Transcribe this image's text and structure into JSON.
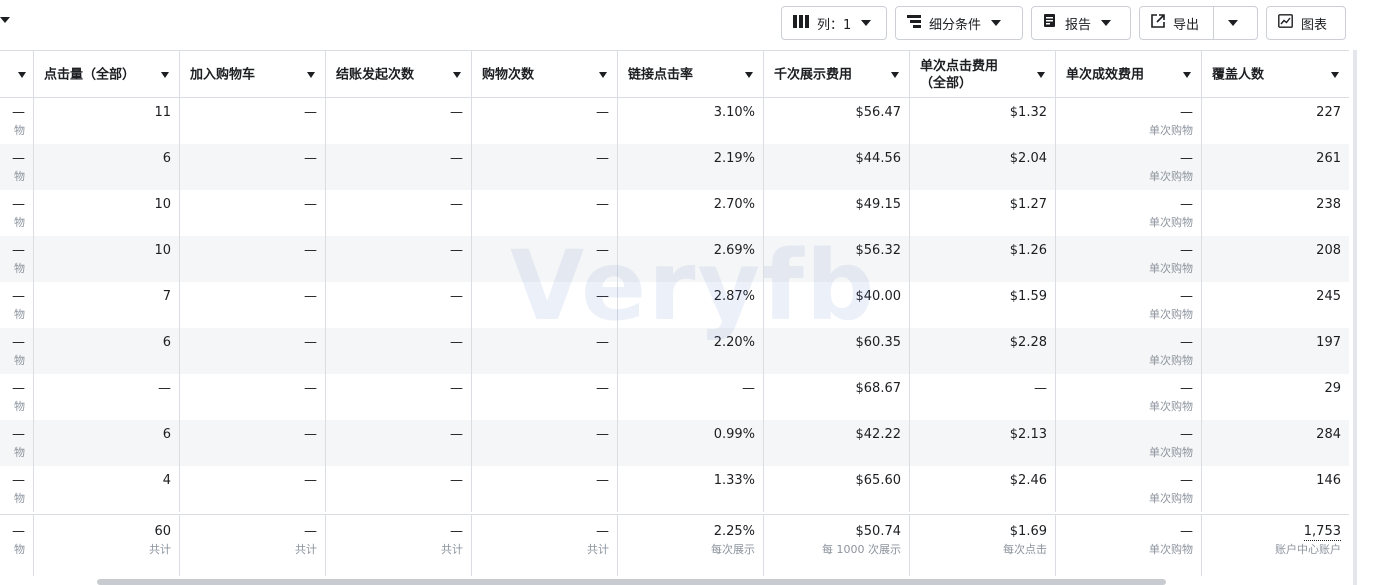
{
  "toolbar": {
    "columns_label": "列：1",
    "breakdown_label": "细分条件",
    "reports_label": "报告",
    "export_label": "导出",
    "charts_label": "图表"
  },
  "watermark": "Veryfb",
  "first_col_partial": {
    "values": [
      "—",
      "—",
      "—",
      "—",
      "—",
      "—",
      "—",
      "—",
      "—"
    ],
    "sub": "物",
    "total_value": "—",
    "total_sub": "物"
  },
  "headers": [
    "点击量（全部）",
    "加入购物车",
    "结账发起次数",
    "购物次数",
    "链接点击率",
    "千次展示费用",
    "单次点击费用\n（全部）",
    "单次成效费用",
    "覆盖人数"
  ],
  "rows": [
    {
      "clicks": "11",
      "atc": "—",
      "checkout": "—",
      "purchases": "—",
      "ctr": "3.10%",
      "cpm": "$56.47",
      "cpc": "$1.32",
      "cpr": "—",
      "cpr_sub": "单次购物",
      "reach": "227"
    },
    {
      "clicks": "6",
      "atc": "—",
      "checkout": "—",
      "purchases": "—",
      "ctr": "2.19%",
      "cpm": "$44.56",
      "cpc": "$2.04",
      "cpr": "—",
      "cpr_sub": "单次购物",
      "reach": "261"
    },
    {
      "clicks": "10",
      "atc": "—",
      "checkout": "—",
      "purchases": "—",
      "ctr": "2.70%",
      "cpm": "$49.15",
      "cpc": "$1.27",
      "cpr": "—",
      "cpr_sub": "单次购物",
      "reach": "238"
    },
    {
      "clicks": "10",
      "atc": "—",
      "checkout": "—",
      "purchases": "—",
      "ctr": "2.69%",
      "cpm": "$56.32",
      "cpc": "$1.26",
      "cpr": "—",
      "cpr_sub": "单次购物",
      "reach": "208"
    },
    {
      "clicks": "7",
      "atc": "—",
      "checkout": "—",
      "purchases": "—",
      "ctr": "2.87%",
      "cpm": "$40.00",
      "cpc": "$1.59",
      "cpr": "—",
      "cpr_sub": "单次购物",
      "reach": "245"
    },
    {
      "clicks": "6",
      "atc": "—",
      "checkout": "—",
      "purchases": "—",
      "ctr": "2.20%",
      "cpm": "$60.35",
      "cpc": "$2.28",
      "cpr": "—",
      "cpr_sub": "单次购物",
      "reach": "197"
    },
    {
      "clicks": "—",
      "atc": "—",
      "checkout": "—",
      "purchases": "—",
      "ctr": "—",
      "cpm": "$68.67",
      "cpc": "—",
      "cpr": "—",
      "cpr_sub": "单次购物",
      "reach": "29"
    },
    {
      "clicks": "6",
      "atc": "—",
      "checkout": "—",
      "purchases": "—",
      "ctr": "0.99%",
      "cpm": "$42.22",
      "cpc": "$2.13",
      "cpr": "—",
      "cpr_sub": "单次购物",
      "reach": "284"
    },
    {
      "clicks": "4",
      "atc": "—",
      "checkout": "—",
      "purchases": "—",
      "ctr": "1.33%",
      "cpm": "$65.60",
      "cpc": "$2.46",
      "cpr": "—",
      "cpr_sub": "单次购物",
      "reach": "146"
    }
  ],
  "totals": {
    "clicks": {
      "v": "60",
      "s": "共计"
    },
    "atc": {
      "v": "—",
      "s": "共计"
    },
    "checkout": {
      "v": "—",
      "s": "共计"
    },
    "purchases": {
      "v": "—",
      "s": "共计"
    },
    "ctr": {
      "v": "2.25%",
      "s": "每次展示"
    },
    "cpm": {
      "v": "$50.74",
      "s": "每 1000 次展示"
    },
    "cpc": {
      "v": "$1.69",
      "s": "每次点击"
    },
    "cpr": {
      "v": "—",
      "s": "单次购物"
    },
    "reach": {
      "v": "1,753",
      "s": "账户中心账户"
    }
  }
}
